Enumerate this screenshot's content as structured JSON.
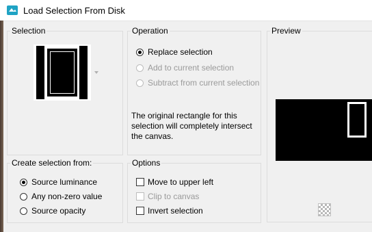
{
  "window": {
    "title": "Load Selection From Disk"
  },
  "selection": {
    "label": "Selection"
  },
  "operation": {
    "label": "Operation",
    "options": [
      {
        "label": "Replace selection",
        "checked": true,
        "enabled": true
      },
      {
        "label": "Add to current selection",
        "checked": false,
        "enabled": false
      },
      {
        "label": "Subtract from current selection",
        "checked": false,
        "enabled": false
      }
    ],
    "note": [
      "The original rectangle for this",
      "selection will completely intersect",
      "the canvas."
    ]
  },
  "preview": {
    "label": "Preview"
  },
  "create_from": {
    "label": "Create selection from:",
    "options": [
      {
        "label": "Source luminance",
        "checked": true
      },
      {
        "label": "Any non-zero value",
        "checked": false
      },
      {
        "label": "Source opacity",
        "checked": false
      }
    ]
  },
  "options": {
    "label": "Options",
    "items": [
      {
        "label": "Move to upper left",
        "checked": false,
        "enabled": true
      },
      {
        "label": "Clip to canvas",
        "checked": false,
        "enabled": false
      },
      {
        "label": "Invert selection",
        "checked": false,
        "enabled": true
      }
    ]
  },
  "colors": {
    "title_bg": "#ffffff",
    "dialog_bg": "#f0f0f0",
    "icon_accent": "#1fa3c4"
  },
  "icons": {
    "app": "selection-disk-icon",
    "preview_toggle": "checker-icon",
    "dropdown": "chevron-down-icon"
  }
}
